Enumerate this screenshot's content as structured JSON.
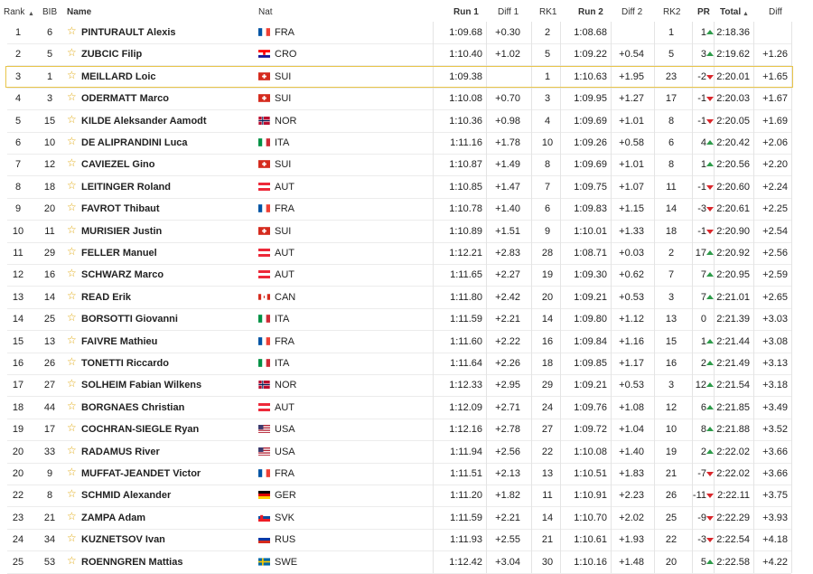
{
  "headers": {
    "rank": "Rank",
    "bib": "BIB",
    "name": "Name",
    "nat": "Nat",
    "run1": "Run 1",
    "diff1": "Diff 1",
    "rk1": "RK1",
    "run2": "Run 2",
    "diff2": "Diff 2",
    "rk2": "RK2",
    "pr": "PR",
    "total": "Total",
    "diff": "Diff"
  },
  "sort_icon": "sort-arrow-icon",
  "highlight_row": 2,
  "colors": {
    "highlight": "#e8c54a",
    "up": "#2e9b4a",
    "down": "#d9262b",
    "star": "#e0a90f"
  },
  "rows": [
    {
      "rank": "1",
      "bib": "6",
      "name": "PINTURAULT Alexis",
      "nat": "FRA",
      "run1": "1:09.68",
      "diff1": "+0.30",
      "rk1": "2",
      "run2": "1:08.68",
      "diff2": "",
      "rk2": "1",
      "pr": "1",
      "trend": "up",
      "total": "2:18.36",
      "diff": ""
    },
    {
      "rank": "2",
      "bib": "5",
      "name": "ZUBCIC Filip",
      "nat": "CRO",
      "run1": "1:10.40",
      "diff1": "+1.02",
      "rk1": "5",
      "run2": "1:09.22",
      "diff2": "+0.54",
      "rk2": "5",
      "pr": "3",
      "trend": "up",
      "total": "2:19.62",
      "diff": "+1.26"
    },
    {
      "rank": "3",
      "bib": "1",
      "name": "MEILLARD Loic",
      "nat": "SUI",
      "run1": "1:09.38",
      "diff1": "",
      "rk1": "1",
      "run2": "1:10.63",
      "diff2": "+1.95",
      "rk2": "23",
      "pr": "-2",
      "trend": "down",
      "total": "2:20.01",
      "diff": "+1.65"
    },
    {
      "rank": "4",
      "bib": "3",
      "name": "ODERMATT Marco",
      "nat": "SUI",
      "run1": "1:10.08",
      "diff1": "+0.70",
      "rk1": "3",
      "run2": "1:09.95",
      "diff2": "+1.27",
      "rk2": "17",
      "pr": "-1",
      "trend": "down",
      "total": "2:20.03",
      "diff": "+1.67"
    },
    {
      "rank": "5",
      "bib": "15",
      "name": "KILDE Aleksander Aamodt",
      "nat": "NOR",
      "run1": "1:10.36",
      "diff1": "+0.98",
      "rk1": "4",
      "run2": "1:09.69",
      "diff2": "+1.01",
      "rk2": "8",
      "pr": "-1",
      "trend": "down",
      "total": "2:20.05",
      "diff": "+1.69"
    },
    {
      "rank": "6",
      "bib": "10",
      "name": "DE ALIPRANDINI Luca",
      "nat": "ITA",
      "run1": "1:11.16",
      "diff1": "+1.78",
      "rk1": "10",
      "run2": "1:09.26",
      "diff2": "+0.58",
      "rk2": "6",
      "pr": "4",
      "trend": "up",
      "total": "2:20.42",
      "diff": "+2.06"
    },
    {
      "rank": "7",
      "bib": "12",
      "name": "CAVIEZEL Gino",
      "nat": "SUI",
      "run1": "1:10.87",
      "diff1": "+1.49",
      "rk1": "8",
      "run2": "1:09.69",
      "diff2": "+1.01",
      "rk2": "8",
      "pr": "1",
      "trend": "up",
      "total": "2:20.56",
      "diff": "+2.20"
    },
    {
      "rank": "8",
      "bib": "18",
      "name": "LEITINGER Roland",
      "nat": "AUT",
      "run1": "1:10.85",
      "diff1": "+1.47",
      "rk1": "7",
      "run2": "1:09.75",
      "diff2": "+1.07",
      "rk2": "11",
      "pr": "-1",
      "trend": "down",
      "total": "2:20.60",
      "diff": "+2.24"
    },
    {
      "rank": "9",
      "bib": "20",
      "name": "FAVROT Thibaut",
      "nat": "FRA",
      "run1": "1:10.78",
      "diff1": "+1.40",
      "rk1": "6",
      "run2": "1:09.83",
      "diff2": "+1.15",
      "rk2": "14",
      "pr": "-3",
      "trend": "down",
      "total": "2:20.61",
      "diff": "+2.25"
    },
    {
      "rank": "10",
      "bib": "11",
      "name": "MURISIER Justin",
      "nat": "SUI",
      "run1": "1:10.89",
      "diff1": "+1.51",
      "rk1": "9",
      "run2": "1:10.01",
      "diff2": "+1.33",
      "rk2": "18",
      "pr": "-1",
      "trend": "down",
      "total": "2:20.90",
      "diff": "+2.54"
    },
    {
      "rank": "11",
      "bib": "29",
      "name": "FELLER Manuel",
      "nat": "AUT",
      "run1": "1:12.21",
      "diff1": "+2.83",
      "rk1": "28",
      "run2": "1:08.71",
      "diff2": "+0.03",
      "rk2": "2",
      "pr": "17",
      "trend": "up",
      "total": "2:20.92",
      "diff": "+2.56"
    },
    {
      "rank": "12",
      "bib": "16",
      "name": "SCHWARZ Marco",
      "nat": "AUT",
      "run1": "1:11.65",
      "diff1": "+2.27",
      "rk1": "19",
      "run2": "1:09.30",
      "diff2": "+0.62",
      "rk2": "7",
      "pr": "7",
      "trend": "up",
      "total": "2:20.95",
      "diff": "+2.59"
    },
    {
      "rank": "13",
      "bib": "14",
      "name": "READ Erik",
      "nat": "CAN",
      "run1": "1:11.80",
      "diff1": "+2.42",
      "rk1": "20",
      "run2": "1:09.21",
      "diff2": "+0.53",
      "rk2": "3",
      "pr": "7",
      "trend": "up",
      "total": "2:21.01",
      "diff": "+2.65"
    },
    {
      "rank": "14",
      "bib": "25",
      "name": "BORSOTTI Giovanni",
      "nat": "ITA",
      "run1": "1:11.59",
      "diff1": "+2.21",
      "rk1": "14",
      "run2": "1:09.80",
      "diff2": "+1.12",
      "rk2": "13",
      "pr": "0",
      "trend": "none",
      "total": "2:21.39",
      "diff": "+3.03"
    },
    {
      "rank": "15",
      "bib": "13",
      "name": "FAIVRE Mathieu",
      "nat": "FRA",
      "run1": "1:11.60",
      "diff1": "+2.22",
      "rk1": "16",
      "run2": "1:09.84",
      "diff2": "+1.16",
      "rk2": "15",
      "pr": "1",
      "trend": "up",
      "total": "2:21.44",
      "diff": "+3.08"
    },
    {
      "rank": "16",
      "bib": "26",
      "name": "TONETTI Riccardo",
      "nat": "ITA",
      "run1": "1:11.64",
      "diff1": "+2.26",
      "rk1": "18",
      "run2": "1:09.85",
      "diff2": "+1.17",
      "rk2": "16",
      "pr": "2",
      "trend": "up",
      "total": "2:21.49",
      "diff": "+3.13"
    },
    {
      "rank": "17",
      "bib": "27",
      "name": "SOLHEIM Fabian Wilkens",
      "nat": "NOR",
      "run1": "1:12.33",
      "diff1": "+2.95",
      "rk1": "29",
      "run2": "1:09.21",
      "diff2": "+0.53",
      "rk2": "3",
      "pr": "12",
      "trend": "up",
      "total": "2:21.54",
      "diff": "+3.18"
    },
    {
      "rank": "18",
      "bib": "44",
      "name": "BORGNAES Christian",
      "nat": "AUT",
      "run1": "1:12.09",
      "diff1": "+2.71",
      "rk1": "24",
      "run2": "1:09.76",
      "diff2": "+1.08",
      "rk2": "12",
      "pr": "6",
      "trend": "up",
      "total": "2:21.85",
      "diff": "+3.49"
    },
    {
      "rank": "19",
      "bib": "17",
      "name": "COCHRAN-SIEGLE Ryan",
      "nat": "USA",
      "run1": "1:12.16",
      "diff1": "+2.78",
      "rk1": "27",
      "run2": "1:09.72",
      "diff2": "+1.04",
      "rk2": "10",
      "pr": "8",
      "trend": "up",
      "total": "2:21.88",
      "diff": "+3.52"
    },
    {
      "rank": "20",
      "bib": "33",
      "name": "RADAMUS River",
      "nat": "USA",
      "run1": "1:11.94",
      "diff1": "+2.56",
      "rk1": "22",
      "run2": "1:10.08",
      "diff2": "+1.40",
      "rk2": "19",
      "pr": "2",
      "trend": "up",
      "total": "2:22.02",
      "diff": "+3.66"
    },
    {
      "rank": "20",
      "bib": "9",
      "name": "MUFFAT-JEANDET Victor",
      "nat": "FRA",
      "run1": "1:11.51",
      "diff1": "+2.13",
      "rk1": "13",
      "run2": "1:10.51",
      "diff2": "+1.83",
      "rk2": "21",
      "pr": "-7",
      "trend": "down",
      "total": "2:22.02",
      "diff": "+3.66"
    },
    {
      "rank": "22",
      "bib": "8",
      "name": "SCHMID Alexander",
      "nat": "GER",
      "run1": "1:11.20",
      "diff1": "+1.82",
      "rk1": "11",
      "run2": "1:10.91",
      "diff2": "+2.23",
      "rk2": "26",
      "pr": "-11",
      "trend": "down",
      "total": "2:22.11",
      "diff": "+3.75"
    },
    {
      "rank": "23",
      "bib": "21",
      "name": "ZAMPA Adam",
      "nat": "SVK",
      "run1": "1:11.59",
      "diff1": "+2.21",
      "rk1": "14",
      "run2": "1:10.70",
      "diff2": "+2.02",
      "rk2": "25",
      "pr": "-9",
      "trend": "down",
      "total": "2:22.29",
      "diff": "+3.93"
    },
    {
      "rank": "24",
      "bib": "34",
      "name": "KUZNETSOV Ivan",
      "nat": "RUS",
      "run1": "1:11.93",
      "diff1": "+2.55",
      "rk1": "21",
      "run2": "1:10.61",
      "diff2": "+1.93",
      "rk2": "22",
      "pr": "-3",
      "trend": "down",
      "total": "2:22.54",
      "diff": "+4.18"
    },
    {
      "rank": "25",
      "bib": "53",
      "name": "ROENNGREN Mattias",
      "nat": "SWE",
      "run1": "1:12.42",
      "diff1": "+3.04",
      "rk1": "30",
      "run2": "1:10.16",
      "diff2": "+1.48",
      "rk2": "20",
      "pr": "5",
      "trend": "up",
      "total": "2:22.58",
      "diff": "+4.22"
    }
  ]
}
